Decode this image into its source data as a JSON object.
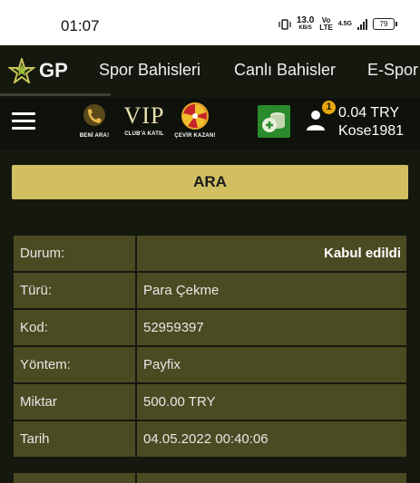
{
  "status_bar": {
    "time": "01:07",
    "network_speed_value": "13.0",
    "network_speed_unit": "KB/S",
    "volte_top": "Vo",
    "volte_bottom": "LTE",
    "data_type": "4.5G",
    "battery": "79"
  },
  "top_nav": {
    "logo_text": "GP",
    "links": [
      "Spor Bahisleri",
      "Canlı Bahisler",
      "E-Spor"
    ]
  },
  "sub_bar": {
    "promos": [
      {
        "caption": "BENİ ARA!"
      },
      {
        "logo": "VIP",
        "caption": "CLUB'A KATIL"
      },
      {
        "caption": "ÇEVİR KAZAN!"
      }
    ],
    "notification_count": "1",
    "balance": "0.04 TRY",
    "username": "Kose1981"
  },
  "search_button": "ARA",
  "details": [
    {
      "label": "Durum:",
      "value": "Kabul edildi"
    },
    {
      "label": "Türü:",
      "value": "Para Çekme"
    },
    {
      "label": "Kod:",
      "value": "52959397"
    },
    {
      "label": "Yöntem:",
      "value": "Payfix"
    },
    {
      "label": "Miktar",
      "value": "500.00 TRY"
    },
    {
      "label": "Tarih",
      "value": "04.05.2022 00:40:06"
    }
  ],
  "colors": {
    "background": "#15180f",
    "accent_button": "#d1bf62",
    "table_cell": "#4b4b23",
    "cash_button": "#2a8a2c",
    "badge": "#e8a70c"
  }
}
